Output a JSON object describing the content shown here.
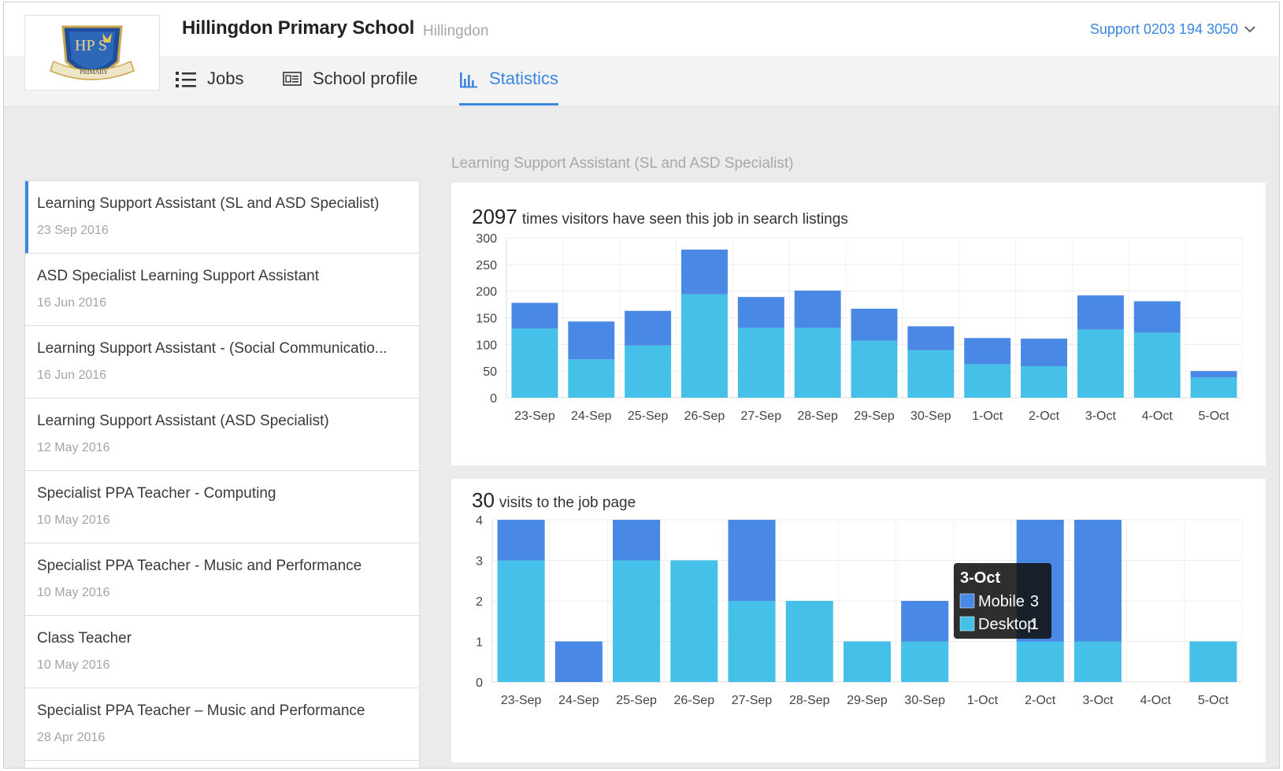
{
  "header": {
    "school_name": "Hillingdon Primary School",
    "school_area": "Hillingdon",
    "support_text": "Support 0203 194 3050",
    "logo_text": "HP S",
    "logo_ribbon": "PRIMARY"
  },
  "nav": {
    "tabs": [
      {
        "label": "Jobs",
        "icon": "list-icon",
        "active": false
      },
      {
        "label": "School profile",
        "icon": "profile-card-icon",
        "active": false
      },
      {
        "label": "Statistics",
        "icon": "bar-chart-icon",
        "active": true
      }
    ]
  },
  "jobs": [
    {
      "title": "Learning Support Assistant (SL and ASD Specialist)",
      "date": "23 Sep 2016",
      "selected": true
    },
    {
      "title": "ASD Specialist Learning Support Assistant",
      "date": "16 Jun 2016"
    },
    {
      "title": "Learning Support Assistant - (Social Communicatio...",
      "date": "16 Jun 2016"
    },
    {
      "title": "Learning Support Assistant (ASD Specialist)",
      "date": "12 May 2016"
    },
    {
      "title": "Specialist PPA Teacher - Computing",
      "date": "10 May 2016"
    },
    {
      "title": "Specialist PPA Teacher - Music and Performance",
      "date": "10 May 2016"
    },
    {
      "title": "Class Teacher",
      "date": "10 May 2016"
    },
    {
      "title": "Specialist PPA Teacher – Music and Performance",
      "date": "28 Apr 2016"
    }
  ],
  "stats": {
    "section_title": "Learning Support Assistant (SL and ASD Specialist)",
    "search_count": "2097",
    "search_label": "times visitors have seen this job in search listings",
    "visits_count": "30",
    "visits_label": "visits to the job page"
  },
  "colors": {
    "mobile": "#4a88e6",
    "desktop": "#45c0e8",
    "accent": "#3a86e0"
  },
  "chart_data": [
    {
      "type": "bar",
      "stacked": true,
      "categories": [
        "23-Sep",
        "24-Sep",
        "25-Sep",
        "26-Sep",
        "27-Sep",
        "28-Sep",
        "29-Sep",
        "30-Sep",
        "1-Oct",
        "2-Oct",
        "3-Oct",
        "4-Oct",
        "5-Oct"
      ],
      "series": [
        {
          "name": "Desktop",
          "color": "#45c0e8",
          "values": [
            130,
            72,
            98,
            194,
            131,
            131,
            107,
            89,
            63,
            59,
            128,
            122,
            38
          ]
        },
        {
          "name": "Mobile",
          "color": "#4a88e6",
          "values": [
            48,
            71,
            65,
            84,
            58,
            70,
            60,
            45,
            49,
            52,
            64,
            59,
            12
          ]
        }
      ],
      "ylim": [
        0,
        300
      ],
      "yticks": [
        0,
        50,
        100,
        150,
        200,
        250,
        300
      ],
      "grid": true
    },
    {
      "type": "bar",
      "stacked": true,
      "categories": [
        "23-Sep",
        "24-Sep",
        "25-Sep",
        "26-Sep",
        "27-Sep",
        "28-Sep",
        "29-Sep",
        "30-Sep",
        "1-Oct",
        "2-Oct",
        "3-Oct",
        "4-Oct",
        "5-Oct"
      ],
      "series": [
        {
          "name": "Desktop",
          "color": "#45c0e8",
          "values": [
            3,
            0,
            3,
            3,
            2,
            2,
            1,
            1,
            0,
            1,
            1,
            0,
            1
          ]
        },
        {
          "name": "Mobile",
          "color": "#4a88e6",
          "values": [
            1,
            1,
            1,
            0,
            2,
            0,
            0,
            1,
            0,
            3,
            3,
            0,
            0
          ]
        }
      ],
      "ylim": [
        0,
        4
      ],
      "yticks": [
        0,
        1,
        2,
        3,
        4
      ],
      "grid": true,
      "tooltip": {
        "title": "3-Oct",
        "rows": [
          {
            "name": "Mobile",
            "value": 3
          },
          {
            "name": "Desktop",
            "value": 1
          }
        ]
      }
    }
  ]
}
